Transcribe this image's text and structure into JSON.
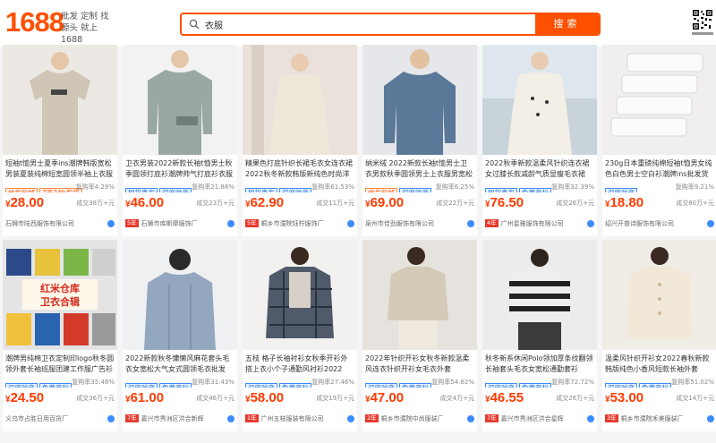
{
  "header": {
    "logo": "1688",
    "slogan": "批发 定制 找源头 就上1688",
    "search_value": "衣服",
    "search_button": "搜索"
  },
  "products": [
    {
      "title": "短袖t恤男士夏季ins潮牌韩版宽松男装夏装纯棉短宽圆领半袖上衣服",
      "tags": [
        "代发包邮",
        "7天24h发货"
      ],
      "hui": "复购率4.29%",
      "price": "28.00",
      "deal": "成交38万+元",
      "shop": "石狮市陆西服饰有限公司",
      "year": "",
      "img": "tee"
    },
    {
      "title": "卫衣男装2022新款长袖t恤男士秋季圆领打底衫潮牌帅气打底衫衣服学生潮",
      "tags": [
        "现货直发",
        "深度验商"
      ],
      "hui": "复购率21.88%",
      "price": "46.00",
      "deal": "成交23万+元",
      "shop": "石狮市库斯摩服饰厂",
      "year": "5年",
      "img": "sweat"
    },
    {
      "title": "精果色打底针织长裙毛衣女连衣裙2022秋冬新款韩版新纯色时尚洋气打底",
      "tags": [
        "现货直发",
        "深度验商"
      ],
      "hui": "复购率61.53%",
      "price": "62.90",
      "deal": "成交11万+元",
      "shop": "桐乡市濮院钰柠服饰厂",
      "year": "5年",
      "img": "dress"
    },
    {
      "title": "纳米绒 2022新款长袖t恤男士卫衣男款秋季圆领男士上衣服男宽松通勤",
      "tags": [
        "代发包邮",
        "深度验商"
      ],
      "hui": "复购率6.25%",
      "price": "69.00",
      "deal": "成交22万+元",
      "shop": "泉州市佳劲服饰有限公司",
      "year": "",
      "img": "blue"
    },
    {
      "title": "2022秋季新款温柔风针织连衣裙女过膝长款减龄气质显瘦毛衣裙",
      "tags": [
        "现货直发",
        "免费商标"
      ],
      "hui": "复购率32.39%",
      "price": "76.50",
      "deal": "成交26万+元",
      "shop": "广州星雅服饰有限公司",
      "year": "4年",
      "img": "knitdress"
    },
    {
      "title": "230g日本重磅纯棉短袖t恤男女纯色白色男士空白衫潮牌ins批发货源",
      "tags": [
        "深度验商"
      ],
      "hui": "复购率9.21%",
      "price": "18.80",
      "deal": "成交80万+元",
      "shop": "绍兴开普诗服饰有限公司",
      "year": "",
      "img": "white"
    },
    {
      "title": "潮牌男纯棉卫衣定制印logo秋冬圆领外套长袖班服团建工作服广告衫",
      "tags": [
        "深度验商",
        "免费商标"
      ],
      "hui": "复购率35.48%",
      "price": "24.50",
      "deal": "成交36万+元",
      "shop": "义乌市占胜日用百货厂",
      "year": "",
      "img": "hoodies"
    },
    {
      "title": "2022新款秋冬慵懒风麻花套头毛衣女宽松大气女式圆领毛衣批发",
      "tags": [
        "深度验商",
        "免费商标"
      ],
      "hui": "复购率31.43%",
      "price": "61.00",
      "deal": "成交46万+元",
      "shop": "嘉兴市秀洲区洪合新辉",
      "year": "7年",
      "img": "cable"
    },
    {
      "title": "五枝 格子长袖衬衫女秋季开衫外搭上衣小个子通勤风衬衫2022",
      "tags": [
        "深度验商",
        "免费商标"
      ],
      "hui": "复购率27.46%",
      "price": "58.00",
      "deal": "成交19万+元",
      "shop": "广州五枝服装有限公司",
      "year": "1年",
      "img": "plaid"
    },
    {
      "title": "2022年针织开衫女秋冬新款温柔风连衣针织开衫女毛衣外套",
      "tags": [
        "深度验商",
        "免费商标"
      ],
      "hui": "复购率54.62%",
      "price": "47.00",
      "deal": "成交4万+元",
      "shop": "桐乡市濮院中尚服装厂",
      "year": "2年",
      "img": "cardigan"
    },
    {
      "title": "秋冬新系休闲Polo领加厚条纹翻领长袖套头毛衣女宽松通勤套衫",
      "tags": [
        "深度验商",
        "免费商标"
      ],
      "hui": "复购率72.72%",
      "price": "46.55",
      "deal": "成交26万+元",
      "shop": "嘉兴市秀洲区洪合星辉",
      "year": "7年",
      "img": "stripe"
    },
    {
      "title": "温柔风针织开衫女2022春秋新款韩版纯色小香风短款长袖外套",
      "tags": [
        "深度验商",
        "免费商标"
      ],
      "hui": "复购率51.02%",
      "price": "53.00",
      "deal": "成交14万+元",
      "shop": "桐乡市濮院禾美服装厂",
      "year": "3年",
      "img": "ivory"
    }
  ],
  "labels": {
    "currency": "¥"
  },
  "colors": {
    "brand": "#ff5000",
    "price": "#ff3b00",
    "tag_blue": "#3c8cff"
  }
}
